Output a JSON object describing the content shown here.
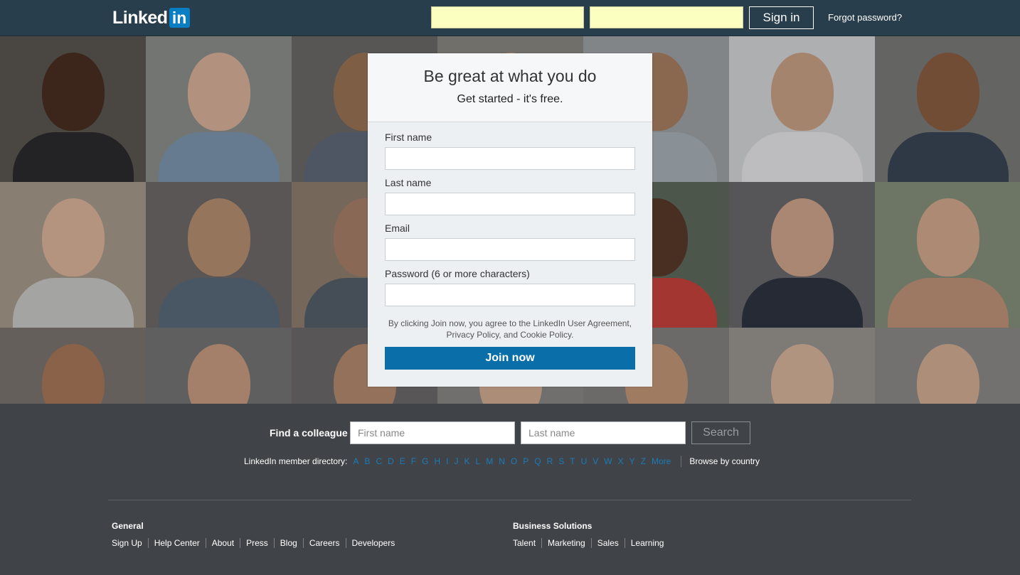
{
  "header": {
    "logo_text": "Linked",
    "logo_box": "in",
    "email_value": "",
    "password_value": "",
    "signin_label": "Sign in",
    "forgot_label": "Forgot password?"
  },
  "signup": {
    "title": "Be great at what you do",
    "subtitle": "Get started - it's free.",
    "fields": [
      {
        "label": "First name"
      },
      {
        "label": "Last name"
      },
      {
        "label": "Email"
      },
      {
        "label": "Password (6 or more characters)"
      }
    ],
    "legal_line1": "By clicking Join now, you agree to the LinkedIn User Agreement,",
    "legal_line2": "Privacy Policy, and Cookie Policy.",
    "join_label": "Join now"
  },
  "find": {
    "label": "Find a colleague",
    "first_placeholder": "First name",
    "last_placeholder": "Last name",
    "search_label": "Search"
  },
  "directory": {
    "label": "LinkedIn member directory:",
    "letters": [
      "A",
      "B",
      "C",
      "D",
      "E",
      "F",
      "G",
      "H",
      "I",
      "J",
      "K",
      "L",
      "M",
      "N",
      "O",
      "P",
      "Q",
      "R",
      "S",
      "T",
      "U",
      "V",
      "W",
      "X",
      "Y",
      "Z",
      "More"
    ],
    "browse_label": "Browse by country"
  },
  "footer": {
    "general": {
      "heading": "General",
      "links": [
        "Sign Up",
        "Help Center",
        "About",
        "Press",
        "Blog",
        "Careers",
        "Developers"
      ]
    },
    "business": {
      "heading": "Business Solutions",
      "links": [
        "Talent",
        "Marketing",
        "Sales",
        "Learning"
      ]
    }
  },
  "colors": {
    "header_bg": "#293e4c",
    "page_bg": "#404448",
    "accent_blue": "#0a6ea8",
    "link_blue": "#1b7bb7",
    "login_field_bg": "#fbffc0"
  }
}
